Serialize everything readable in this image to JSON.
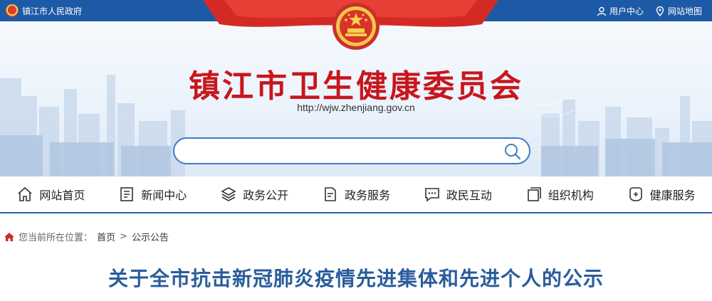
{
  "topbar": {
    "gov_label": "镇江市人民政府",
    "user_center": "用户中心",
    "site_map": "网站地图"
  },
  "banner": {
    "site_title": "镇江市卫生健康委员会",
    "site_url": "http://wjw.zhenjiang.gov.cn",
    "search_placeholder": ""
  },
  "nav": {
    "items": [
      {
        "label": "网站首页",
        "icon": "home-icon"
      },
      {
        "label": "新闻中心",
        "icon": "news-icon"
      },
      {
        "label": "政务公开",
        "icon": "layers-icon"
      },
      {
        "label": "政务服务",
        "icon": "form-icon"
      },
      {
        "label": "政民互动",
        "icon": "chat-icon"
      },
      {
        "label": "组织机构",
        "icon": "org-icon"
      },
      {
        "label": "健康服务",
        "icon": "health-icon"
      }
    ]
  },
  "breadcrumb": {
    "prefix": "您当前所在位置：",
    "home": "首页",
    "separator": ">",
    "current": "公示公告"
  },
  "article": {
    "title": "关于全市抗击新冠肺炎疫情先进集体和先进个人的公示"
  },
  "colors": {
    "topbar": "#1d5aa5",
    "title_red": "#c8161d",
    "article_blue": "#2a5c9c",
    "nav_border": "#2a63ad"
  }
}
